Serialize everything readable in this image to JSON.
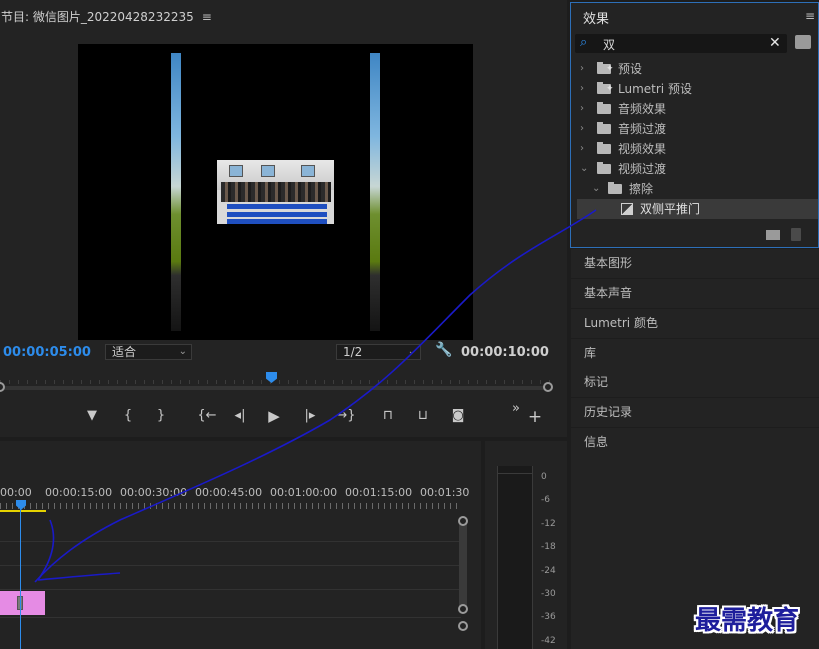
{
  "monitor": {
    "title": "节目: 微信图片_20220428232235",
    "menu_glyph": "≡",
    "timecode_current": "00:00:05:00",
    "timecode_duration": "00:00:10:00",
    "zoom_select": "适合",
    "resolution_select": "1/2",
    "transport": {
      "add_marker": "▼",
      "mark_in": "{",
      "mark_out": "}",
      "go_to_in": "{←",
      "step_back": "◂|",
      "play": "▶",
      "step_forward": "|▸",
      "go_to_out": "→}",
      "lift": "⊓",
      "extract": "⊔",
      "export_frame": "◙",
      "more": "»",
      "add": "+"
    }
  },
  "timeline": {
    "ruler_labels": [
      "00:00",
      "00:00:15:00",
      "00:00:30:00",
      "00:00:45:00",
      "00:01:00:00",
      "00:01:15:00",
      "00:01:30"
    ]
  },
  "meter": {
    "labels": [
      "0",
      "-6",
      "-12",
      "-18",
      "-24",
      "-30",
      "-36",
      "-42"
    ]
  },
  "effects": {
    "title": "效果",
    "menu_glyph": "≡",
    "search_value": "双",
    "clear_glyph": "✕",
    "tree": [
      {
        "label": "预设",
        "expanded": false,
        "level": 0,
        "type": "preset"
      },
      {
        "label": "Lumetri 预设",
        "expanded": false,
        "level": 0,
        "type": "preset"
      },
      {
        "label": "音频效果",
        "expanded": false,
        "level": 0,
        "type": "folder"
      },
      {
        "label": "音频过渡",
        "expanded": false,
        "level": 0,
        "type": "folder"
      },
      {
        "label": "视频效果",
        "expanded": false,
        "level": 0,
        "type": "folder"
      },
      {
        "label": "视频过渡",
        "expanded": true,
        "level": 0,
        "type": "folder"
      },
      {
        "label": "擦除",
        "expanded": true,
        "level": 1,
        "type": "folder"
      },
      {
        "label": "双侧平推门",
        "expanded": false,
        "level": 2,
        "type": "effect",
        "selected": true
      }
    ]
  },
  "panels": [
    "基本图形",
    "基本声音",
    "Lumetri 颜色",
    "库",
    "标记",
    "历史记录",
    "信息"
  ],
  "watermark": "最需教育",
  "colors": {
    "accent": "#2d8ceb",
    "clip": "#e58be4",
    "in_out_bar": "#e6d300",
    "annotation": "#1a1ac8"
  }
}
